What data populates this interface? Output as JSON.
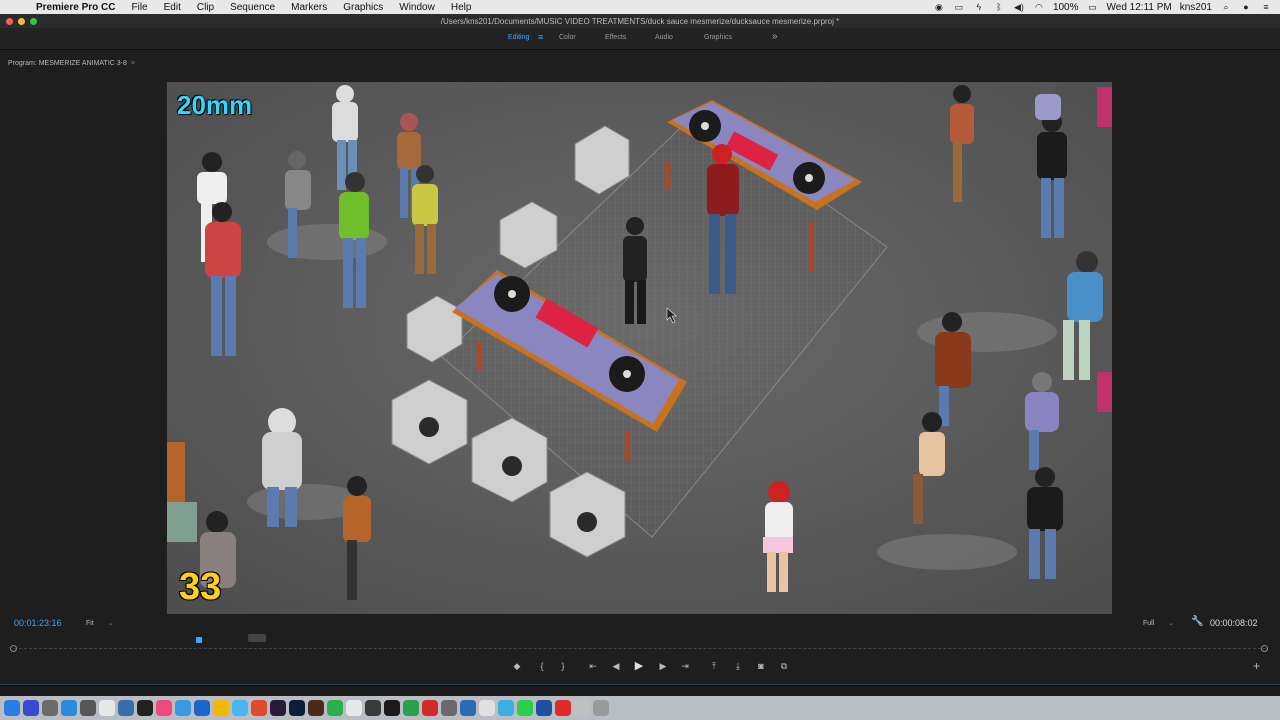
{
  "menubar": {
    "app_name": "Premiere Pro CC",
    "items": [
      "File",
      "Edit",
      "Clip",
      "Sequence",
      "Markers",
      "Graphics",
      "Window",
      "Help"
    ],
    "battery": "100%",
    "clock": "Wed 12:11 PM",
    "user": "kns201"
  },
  "titlebar": {
    "path": "/Users/kns201/Documents/MUSIC VIDEO TREATMENTS/duck sauce mesmerize/ducksauce mesmerize.prproj *"
  },
  "workspaces": {
    "tabs": [
      "Editing",
      "Color",
      "Effects",
      "Audio",
      "Graphics"
    ],
    "active": "Editing"
  },
  "monitor": {
    "title": "Program: MESMERIZE ANIMATIC 3-8",
    "overlay_lens": "20mm",
    "overlay_frame": "33",
    "timecode": "00:01:23:16",
    "zoom": "Fit",
    "resolution": "Full",
    "duration": "00:00:08:02"
  },
  "colors": {
    "accent": "#3ea6ff",
    "lens_text": "#35d6ff",
    "frame_text": "#ffd020",
    "stage_top": "#7b79b8",
    "stage_wood": "#c9721c",
    "table_legs": "#b5441f"
  },
  "transport": {
    "icons": [
      "marker-icon",
      "mark-in-icon",
      "mark-out-icon",
      "go-to-in-icon",
      "step-back-icon",
      "play-icon",
      "step-forward-icon",
      "go-to-out-icon",
      "lift-icon",
      "extract-icon",
      "export-frame-icon",
      "compare-icon"
    ]
  }
}
